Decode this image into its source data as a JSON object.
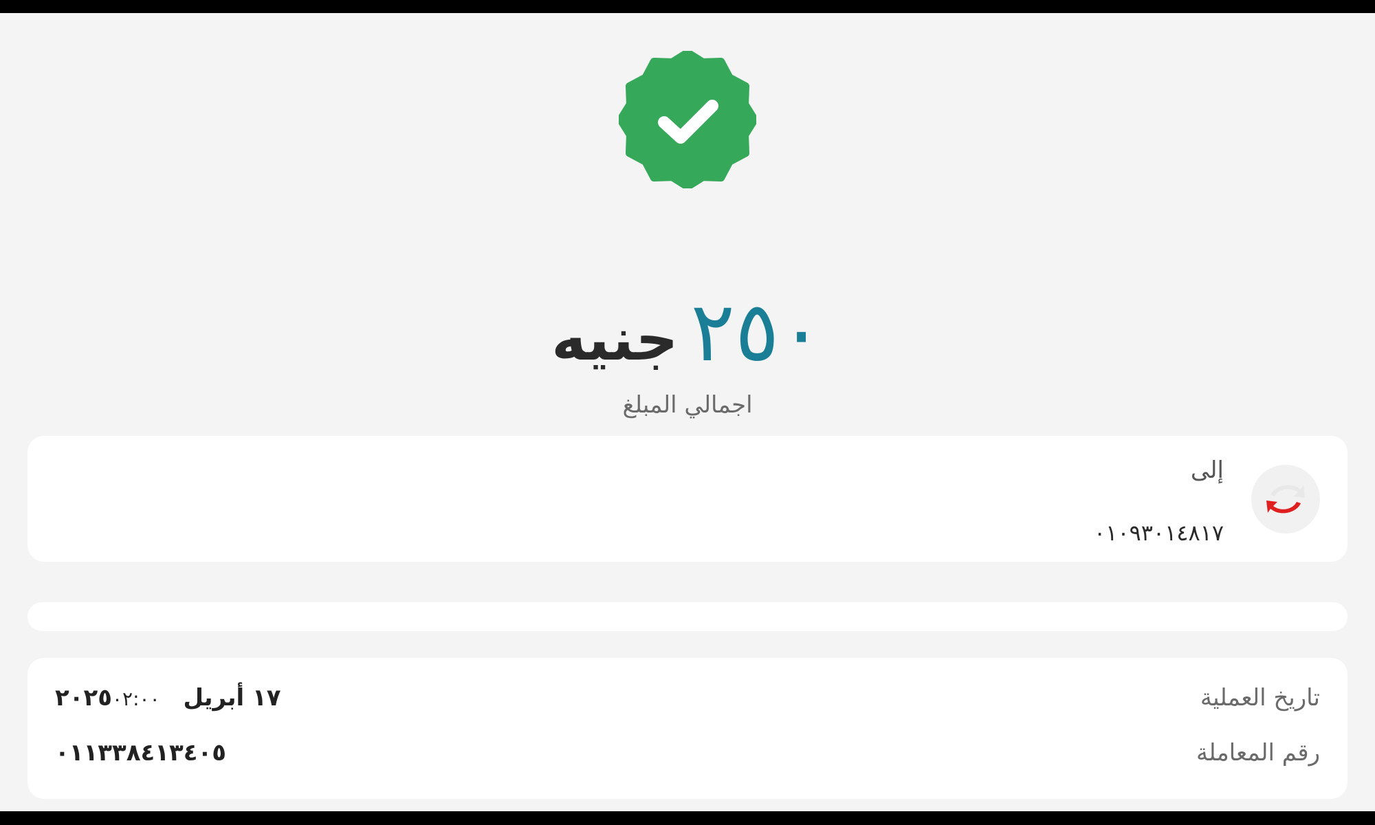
{
  "status": {
    "icon": "check-badge-icon",
    "color": "#35a85a"
  },
  "amount": {
    "value": "٢٥٠",
    "currency": "جنيه",
    "caption": "اجمالي المبلغ",
    "value_color": "#1a7f96"
  },
  "recipient": {
    "label": "إلى",
    "phone": "٠١٠٩٣٠١٤٨١٧",
    "avatar_icon": "transfer-arrows-icon"
  },
  "details": {
    "date_label": "تاريخ العملية",
    "date_value": "١٧ أبريل ٢٠٢٥",
    "time_value": "٠٢:٠٠",
    "txn_label": "رقم المعاملة",
    "txn_value": "٠١١٣٣٨٤١٣٤٠٥"
  }
}
